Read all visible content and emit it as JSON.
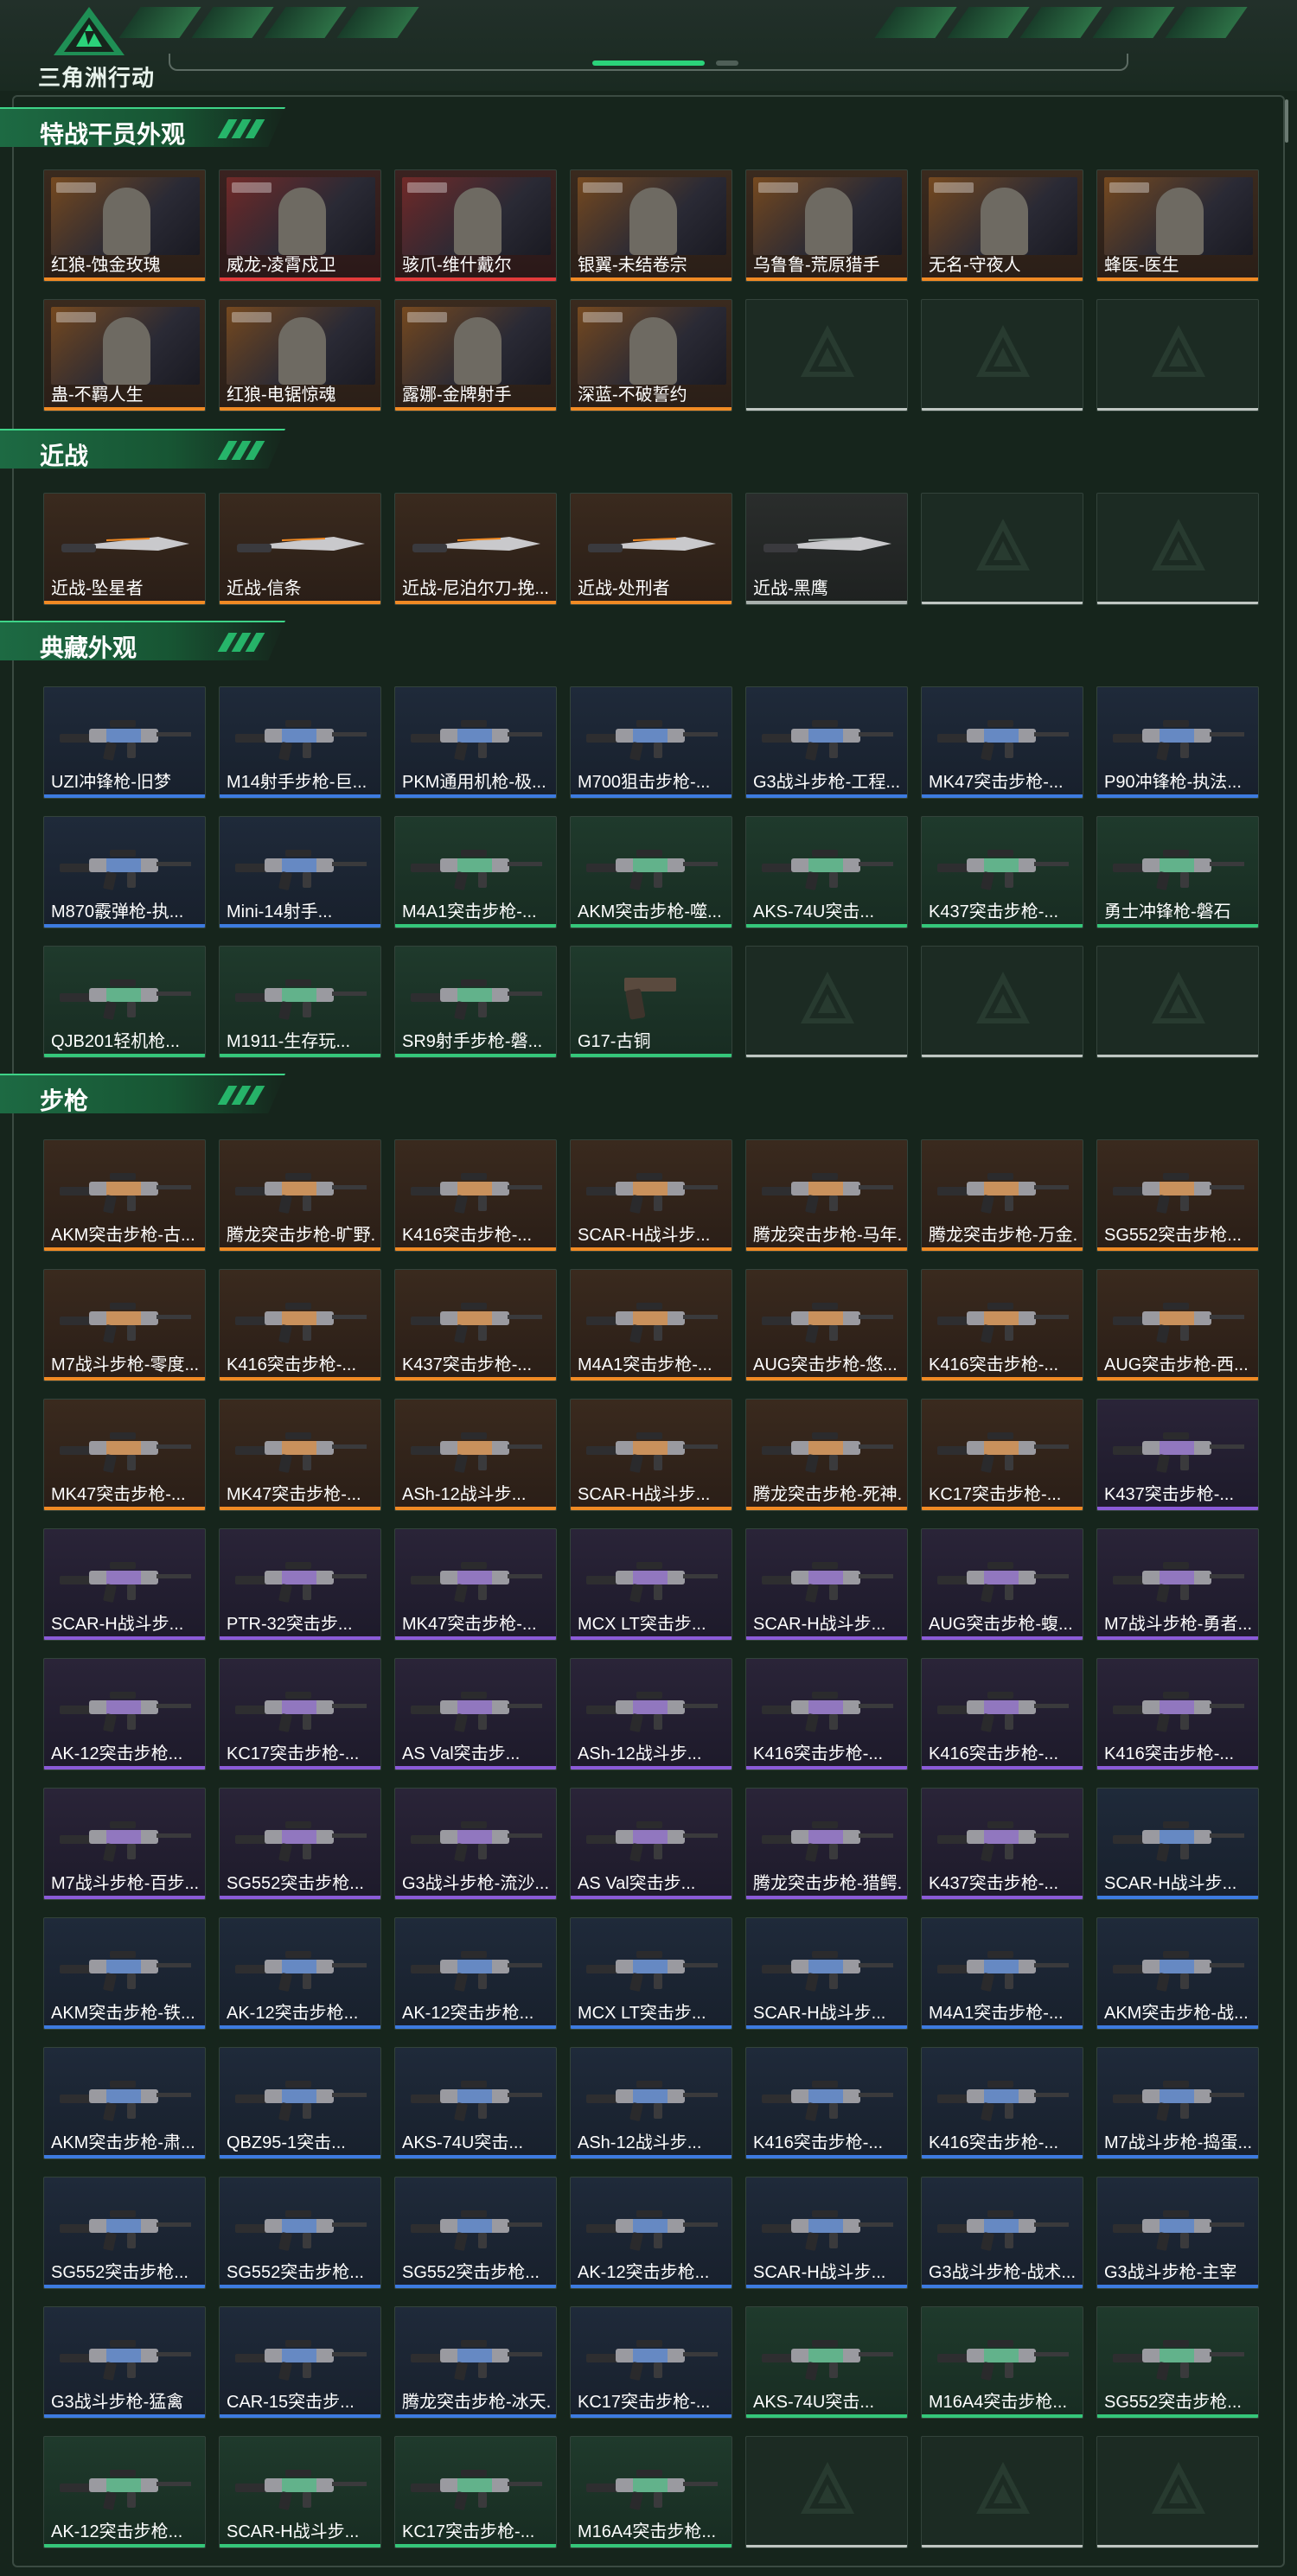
{
  "header": {
    "logo_text": "三角洲行动"
  },
  "colors": {
    "orange": "#f08a24",
    "red": "#e23b3b",
    "purple": "#8b5bd8",
    "blue": "#3d7be0",
    "green": "#35c77a",
    "grey": "#a8b0ac",
    "accent": "#2bd37a"
  },
  "sections": [
    {
      "title": "特战干员外观",
      "items": [
        {
          "label": "红狼-蚀金玫瑰",
          "rarity": "orange",
          "kind": "portrait"
        },
        {
          "label": "威龙-凌霄戍卫",
          "rarity": "red",
          "kind": "portrait"
        },
        {
          "label": "骇爪-维什戴尔",
          "rarity": "red",
          "kind": "portrait"
        },
        {
          "label": "银翼-未结卷宗",
          "rarity": "orange",
          "kind": "portrait"
        },
        {
          "label": "乌鲁鲁-荒原猎手",
          "rarity": "orange",
          "kind": "portrait"
        },
        {
          "label": "无名-守夜人",
          "rarity": "orange",
          "kind": "portrait"
        },
        {
          "label": "蜂医-医生",
          "rarity": "orange",
          "kind": "portrait"
        },
        {
          "label": "蛊-不羁人生",
          "rarity": "orange",
          "kind": "portrait"
        },
        {
          "label": "红狼-电锯惊魂",
          "rarity": "orange",
          "kind": "portrait"
        },
        {
          "label": "露娜-金牌射手",
          "rarity": "orange",
          "kind": "portrait"
        },
        {
          "label": "深蓝-不破誓约",
          "rarity": "orange",
          "kind": "portrait"
        },
        {
          "label": "",
          "rarity": "empty"
        },
        {
          "label": "",
          "rarity": "empty"
        },
        {
          "label": "",
          "rarity": "empty"
        }
      ]
    },
    {
      "title": "近战",
      "items": [
        {
          "label": "近战-坠星者",
          "rarity": "orange",
          "kind": "knife"
        },
        {
          "label": "近战-信条",
          "rarity": "orange",
          "kind": "knife"
        },
        {
          "label": "近战-尼泊尔刀-挽...",
          "rarity": "orange",
          "kind": "knife"
        },
        {
          "label": "近战-处刑者",
          "rarity": "orange",
          "kind": "knife"
        },
        {
          "label": "近战-黑鹰",
          "rarity": "grey",
          "kind": "knife"
        },
        {
          "label": "",
          "rarity": "empty"
        },
        {
          "label": "",
          "rarity": "empty"
        }
      ]
    },
    {
      "title": "典藏外观",
      "items": [
        {
          "label": "UZI冲锋枪-旧梦",
          "rarity": "blue",
          "kind": "gun"
        },
        {
          "label": "M14射手步枪-巨...",
          "rarity": "blue",
          "kind": "gun"
        },
        {
          "label": "PKM通用机枪-极...",
          "rarity": "blue",
          "kind": "gun"
        },
        {
          "label": "M700狙击步枪-...",
          "rarity": "blue",
          "kind": "gun"
        },
        {
          "label": "G3战斗步枪-工程...",
          "rarity": "blue",
          "kind": "gun"
        },
        {
          "label": "MK47突击步枪-...",
          "rarity": "blue",
          "kind": "gun"
        },
        {
          "label": "P90冲锋枪-执法...",
          "rarity": "blue",
          "kind": "gun"
        },
        {
          "label": "M870霰弹枪-执...",
          "rarity": "blue",
          "kind": "gun"
        },
        {
          "label": "Mini-14射手...",
          "rarity": "blue",
          "kind": "gun"
        },
        {
          "label": "M4A1突击步枪-...",
          "rarity": "green",
          "kind": "gun"
        },
        {
          "label": "AKM突击步枪-噬...",
          "rarity": "green",
          "kind": "gun"
        },
        {
          "label": "AKS-74U突击...",
          "rarity": "green",
          "kind": "gun"
        },
        {
          "label": "K437突击步枪-...",
          "rarity": "green",
          "kind": "gun"
        },
        {
          "label": "勇士冲锋枪-磐石",
          "rarity": "green",
          "kind": "gun"
        },
        {
          "label": "QJB201轻机枪...",
          "rarity": "green",
          "kind": "gun"
        },
        {
          "label": "M1911-生存玩...",
          "rarity": "green",
          "kind": "gun"
        },
        {
          "label": "SR9射手步枪-磐...",
          "rarity": "green",
          "kind": "gun"
        },
        {
          "label": "G17-古铜",
          "rarity": "green",
          "kind": "pistol"
        },
        {
          "label": "",
          "rarity": "empty"
        },
        {
          "label": "",
          "rarity": "empty"
        },
        {
          "label": "",
          "rarity": "empty"
        }
      ]
    },
    {
      "title": "步枪",
      "items": [
        {
          "label": "AKM突击步枪-古...",
          "rarity": "orange",
          "kind": "gun"
        },
        {
          "label": "腾龙突击步枪-旷野...",
          "rarity": "orange",
          "kind": "gun"
        },
        {
          "label": "K416突击步枪-...",
          "rarity": "orange",
          "kind": "gun"
        },
        {
          "label": "SCAR-H战斗步...",
          "rarity": "orange",
          "kind": "gun"
        },
        {
          "label": "腾龙突击步枪-马年...",
          "rarity": "orange",
          "kind": "gun"
        },
        {
          "label": "腾龙突击步枪-万金...",
          "rarity": "orange",
          "kind": "gun"
        },
        {
          "label": "SG552突击步枪...",
          "rarity": "orange",
          "kind": "gun"
        },
        {
          "label": "M7战斗步枪-零度...",
          "rarity": "orange",
          "kind": "gun"
        },
        {
          "label": "K416突击步枪-...",
          "rarity": "orange",
          "kind": "gun"
        },
        {
          "label": "K437突击步枪-...",
          "rarity": "orange",
          "kind": "gun"
        },
        {
          "label": "M4A1突击步枪-...",
          "rarity": "orange",
          "kind": "gun"
        },
        {
          "label": "AUG突击步枪-悠...",
          "rarity": "orange",
          "kind": "gun"
        },
        {
          "label": "K416突击步枪-...",
          "rarity": "orange",
          "kind": "gun"
        },
        {
          "label": "AUG突击步枪-西...",
          "rarity": "orange",
          "kind": "gun"
        },
        {
          "label": "MK47突击步枪-...",
          "rarity": "orange",
          "kind": "gun"
        },
        {
          "label": "MK47突击步枪-...",
          "rarity": "orange",
          "kind": "gun"
        },
        {
          "label": "ASh-12战斗步...",
          "rarity": "orange",
          "kind": "gun"
        },
        {
          "label": "SCAR-H战斗步...",
          "rarity": "orange",
          "kind": "gun"
        },
        {
          "label": "腾龙突击步枪-死神...",
          "rarity": "orange",
          "kind": "gun"
        },
        {
          "label": "KC17突击步枪-...",
          "rarity": "orange",
          "kind": "gun"
        },
        {
          "label": "K437突击步枪-...",
          "rarity": "purple",
          "kind": "gun"
        },
        {
          "label": "SCAR-H战斗步...",
          "rarity": "purple",
          "kind": "gun"
        },
        {
          "label": "PTR-32突击步...",
          "rarity": "purple",
          "kind": "gun"
        },
        {
          "label": "MK47突击步枪-...",
          "rarity": "purple",
          "kind": "gun"
        },
        {
          "label": "MCX LT突击步...",
          "rarity": "purple",
          "kind": "gun"
        },
        {
          "label": "SCAR-H战斗步...",
          "rarity": "purple",
          "kind": "gun"
        },
        {
          "label": "AUG突击步枪-蝮...",
          "rarity": "purple",
          "kind": "gun"
        },
        {
          "label": "M7战斗步枪-勇者...",
          "rarity": "purple",
          "kind": "gun"
        },
        {
          "label": "AK-12突击步枪...",
          "rarity": "purple",
          "kind": "gun"
        },
        {
          "label": "KC17突击步枪-...",
          "rarity": "purple",
          "kind": "gun"
        },
        {
          "label": "AS Val突击步...",
          "rarity": "purple",
          "kind": "gun"
        },
        {
          "label": "ASh-12战斗步...",
          "rarity": "purple",
          "kind": "gun"
        },
        {
          "label": "K416突击步枪-...",
          "rarity": "purple",
          "kind": "gun"
        },
        {
          "label": "K416突击步枪-...",
          "rarity": "purple",
          "kind": "gun"
        },
        {
          "label": "K416突击步枪-...",
          "rarity": "purple",
          "kind": "gun"
        },
        {
          "label": "M7战斗步枪-百步...",
          "rarity": "purple",
          "kind": "gun"
        },
        {
          "label": "SG552突击步枪...",
          "rarity": "purple",
          "kind": "gun"
        },
        {
          "label": "G3战斗步枪-流沙...",
          "rarity": "purple",
          "kind": "gun"
        },
        {
          "label": "AS Val突击步...",
          "rarity": "purple",
          "kind": "gun"
        },
        {
          "label": "腾龙突击步枪-猎鳄...",
          "rarity": "purple",
          "kind": "gun"
        },
        {
          "label": "K437突击步枪-...",
          "rarity": "purple",
          "kind": "gun"
        },
        {
          "label": "SCAR-H战斗步...",
          "rarity": "blue",
          "kind": "gun"
        },
        {
          "label": "AKM突击步枪-铁...",
          "rarity": "blue",
          "kind": "gun"
        },
        {
          "label": "AK-12突击步枪...",
          "rarity": "blue",
          "kind": "gun"
        },
        {
          "label": "AK-12突击步枪...",
          "rarity": "blue",
          "kind": "gun"
        },
        {
          "label": "MCX LT突击步...",
          "rarity": "blue",
          "kind": "gun"
        },
        {
          "label": "SCAR-H战斗步...",
          "rarity": "blue",
          "kind": "gun"
        },
        {
          "label": "M4A1突击步枪-...",
          "rarity": "blue",
          "kind": "gun"
        },
        {
          "label": "AKM突击步枪-战...",
          "rarity": "blue",
          "kind": "gun"
        },
        {
          "label": "AKM突击步枪-肃...",
          "rarity": "blue",
          "kind": "gun"
        },
        {
          "label": "QBZ95-1突击...",
          "rarity": "blue",
          "kind": "gun"
        },
        {
          "label": "AKS-74U突击...",
          "rarity": "blue",
          "kind": "gun"
        },
        {
          "label": "ASh-12战斗步...",
          "rarity": "blue",
          "kind": "gun"
        },
        {
          "label": "K416突击步枪-...",
          "rarity": "blue",
          "kind": "gun"
        },
        {
          "label": "K416突击步枪-...",
          "rarity": "blue",
          "kind": "gun"
        },
        {
          "label": "M7战斗步枪-捣蛋...",
          "rarity": "blue",
          "kind": "gun"
        },
        {
          "label": "SG552突击步枪...",
          "rarity": "blue",
          "kind": "gun"
        },
        {
          "label": "SG552突击步枪...",
          "rarity": "blue",
          "kind": "gun"
        },
        {
          "label": "SG552突击步枪...",
          "rarity": "blue",
          "kind": "gun"
        },
        {
          "label": "AK-12突击步枪...",
          "rarity": "blue",
          "kind": "gun"
        },
        {
          "label": "SCAR-H战斗步...",
          "rarity": "blue",
          "kind": "gun"
        },
        {
          "label": "G3战斗步枪-战术...",
          "rarity": "blue",
          "kind": "gun"
        },
        {
          "label": "G3战斗步枪-主宰",
          "rarity": "blue",
          "kind": "gun"
        },
        {
          "label": "G3战斗步枪-猛禽",
          "rarity": "blue",
          "kind": "gun"
        },
        {
          "label": "CAR-15突击步...",
          "rarity": "blue",
          "kind": "gun"
        },
        {
          "label": "腾龙突击步枪-冰天...",
          "rarity": "blue",
          "kind": "gun"
        },
        {
          "label": "KC17突击步枪-...",
          "rarity": "blue",
          "kind": "gun"
        },
        {
          "label": "AKS-74U突击...",
          "rarity": "green",
          "kind": "gun"
        },
        {
          "label": "M16A4突击步枪...",
          "rarity": "green",
          "kind": "gun"
        },
        {
          "label": "SG552突击步枪...",
          "rarity": "green",
          "kind": "gun"
        },
        {
          "label": "AK-12突击步枪...",
          "rarity": "green",
          "kind": "gun"
        },
        {
          "label": "SCAR-H战斗步...",
          "rarity": "green",
          "kind": "gun"
        },
        {
          "label": "KC17突击步枪-...",
          "rarity": "green",
          "kind": "gun"
        },
        {
          "label": "M16A4突击步枪...",
          "rarity": "green",
          "kind": "gun"
        },
        {
          "label": "",
          "rarity": "empty"
        },
        {
          "label": "",
          "rarity": "empty"
        },
        {
          "label": "",
          "rarity": "empty"
        }
      ]
    }
  ]
}
